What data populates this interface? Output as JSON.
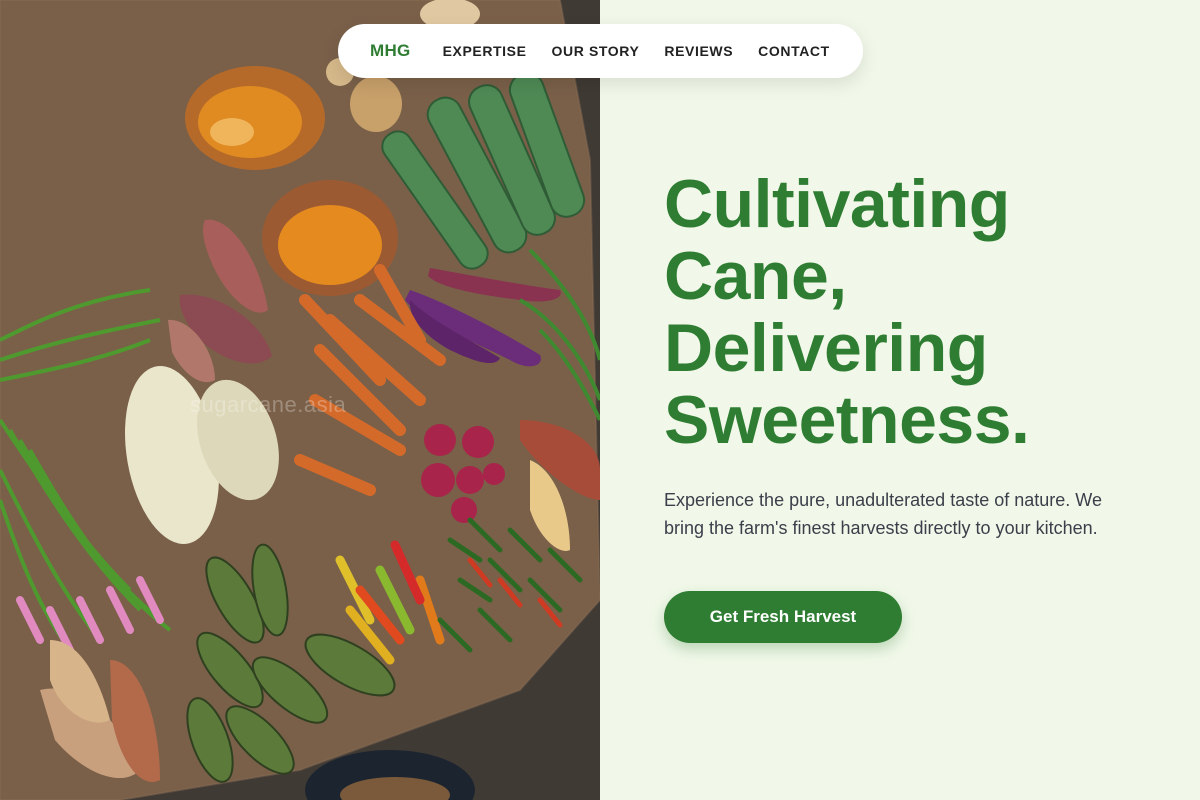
{
  "nav": {
    "brand": "MHG",
    "links": [
      "EXPERTISE",
      "OUR STORY",
      "REVIEWS",
      "CONTACT"
    ]
  },
  "hero": {
    "heading_lines": [
      "Cultivating",
      "Cane,",
      "Delivering",
      "Sweetness."
    ],
    "description": "Experience the pure, unadulterated taste of nature. We bring the farm's finest harvests directly to your kitchen.",
    "cta_label": "Get Fresh Harvest"
  },
  "image": {
    "watermark": "sugarcane.asia",
    "subject": "market-vegetables-photo"
  },
  "colors": {
    "brand_green": "#2e7d32",
    "page_background": "#f1f8e9",
    "body_text": "#3a3f4a"
  }
}
